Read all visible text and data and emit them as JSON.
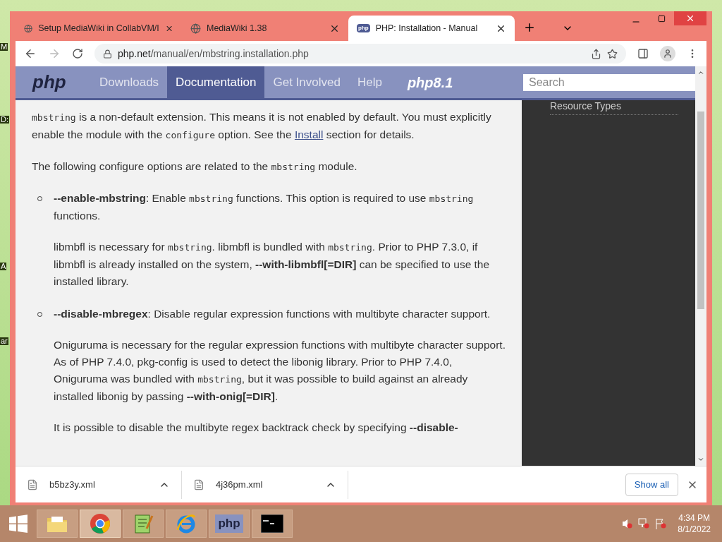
{
  "desktop_labels": [
    "M",
    "D:",
    "A",
    "ar"
  ],
  "tabs": [
    {
      "title": "Setup MediaWiki in CollabVM/I",
      "kind": "web",
      "selected": false
    },
    {
      "title": "MediaWiki 1.38",
      "kind": "web",
      "selected": false
    },
    {
      "title": "PHP: Installation - Manual",
      "kind": "favicon",
      "favicon_text": "php",
      "selected": true
    }
  ],
  "address": {
    "host": "php.net",
    "path": "/manual/en/mbstring.installation.php"
  },
  "site_nav": {
    "logo": "php",
    "items": [
      {
        "label": "Downloads",
        "selected": false
      },
      {
        "label": "Documentation",
        "selected": true
      },
      {
        "label": "Get Involved",
        "selected": false
      },
      {
        "label": "Help",
        "selected": false
      }
    ],
    "banner": "php8.1",
    "search_placeholder": "Search"
  },
  "sidebar": {
    "items": [
      "Resource Types"
    ]
  },
  "content": [
    {
      "kind": "para",
      "segments": [
        {
          "kind": "code",
          "text": "mbstring"
        },
        {
          "kind": "text",
          "text": " is a non-default extension. This means it is not enabled by default. You must explicitly enable the module with the "
        },
        {
          "kind": "code",
          "text": "configure"
        },
        {
          "kind": "text",
          "text": " option. See the "
        },
        {
          "kind": "link",
          "text": "Install"
        },
        {
          "kind": "text",
          "text": " section for details."
        }
      ]
    },
    {
      "kind": "para",
      "segments": [
        {
          "kind": "text",
          "text": "The following configure options are related to the "
        },
        {
          "kind": "code",
          "text": "mbstring"
        },
        {
          "kind": "text",
          "text": " module."
        }
      ]
    },
    {
      "kind": "item",
      "paras": [
        [
          {
            "kind": "bold",
            "text": "--enable-mbstring"
          },
          {
            "kind": "text",
            "text": ": Enable "
          },
          {
            "kind": "code",
            "text": "mbstring"
          },
          {
            "kind": "text",
            "text": " functions. This option is required to use "
          },
          {
            "kind": "code",
            "text": "mbstring"
          },
          {
            "kind": "text",
            "text": " functions."
          }
        ],
        [
          {
            "kind": "text",
            "text": "libmbfl is necessary for "
          },
          {
            "kind": "code",
            "text": "mbstring"
          },
          {
            "kind": "text",
            "text": ". libmbfl is bundled with "
          },
          {
            "kind": "code",
            "text": "mbstring"
          },
          {
            "kind": "text",
            "text": ". Prior to PHP 7.3.0, if libmbfl is already installed on the system, "
          },
          {
            "kind": "bold",
            "text": "--with-libmbfl[=DIR]"
          },
          {
            "kind": "text",
            "text": " can be specified to use the installed library."
          }
        ]
      ]
    },
    {
      "kind": "item",
      "paras": [
        [
          {
            "kind": "bold",
            "text": "--disable-mbregex"
          },
          {
            "kind": "text",
            "text": ": Disable regular expression functions with multibyte character support."
          }
        ],
        [
          {
            "kind": "text",
            "text": "Oniguruma is necessary for the regular expression functions with multibyte character support. As of PHP 7.4.0, pkg-config is used to detect the libonig library. Prior to PHP 7.4.0, Oniguruma was bundled with "
          },
          {
            "kind": "code",
            "text": "mbstring"
          },
          {
            "kind": "text",
            "text": ", but it was possible to build against an already installed libonig by passing "
          },
          {
            "kind": "bold",
            "text": "--with-onig[=DIR]"
          },
          {
            "kind": "text",
            "text": "."
          }
        ],
        [
          {
            "kind": "text",
            "text": "It is possible to disable the multibyte regex backtrack check by specifying "
          },
          {
            "kind": "bold",
            "text": "--disable-"
          }
        ]
      ]
    }
  ],
  "downloads": [
    {
      "name": "b5bz3y.xml"
    },
    {
      "name": "4j36pm.xml"
    }
  ],
  "show_all": "Show all",
  "taskbar": {
    "apps": [
      {
        "kind": "folder",
        "active": false
      },
      {
        "kind": "chrome",
        "active": true
      },
      {
        "kind": "notepad",
        "active": false
      },
      {
        "kind": "ie",
        "active": false
      },
      {
        "kind": "php",
        "label": "php",
        "active": false
      },
      {
        "kind": "cmd",
        "active": false
      }
    ],
    "time": "4:34 PM",
    "date": "8/1/2022"
  }
}
